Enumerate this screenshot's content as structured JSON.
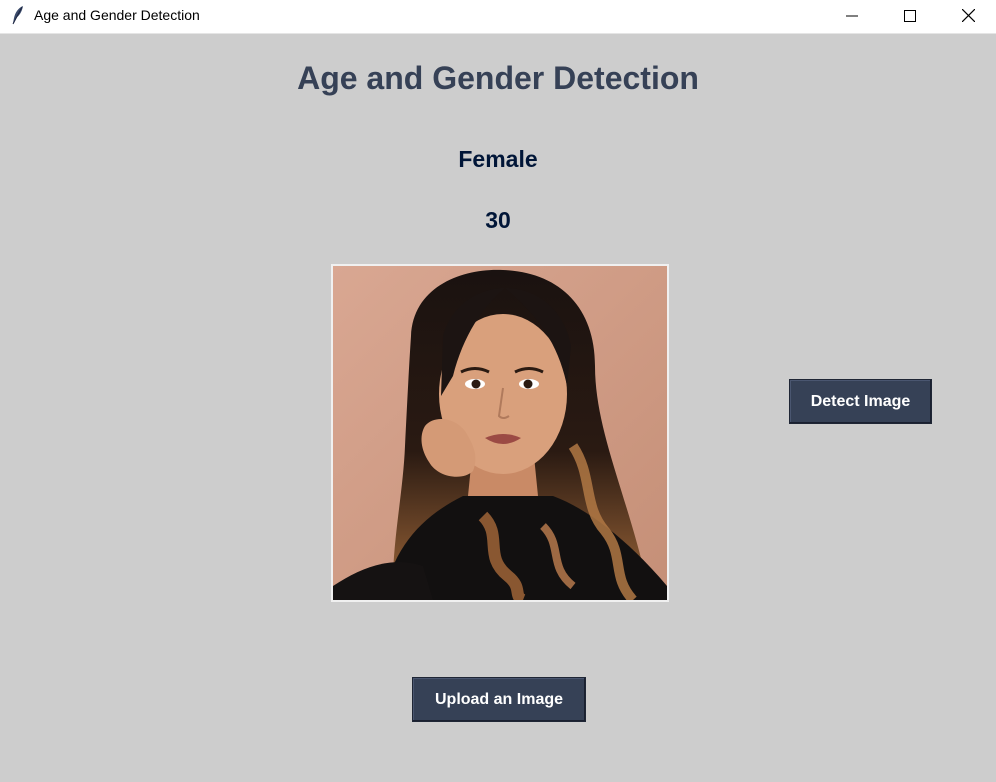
{
  "window": {
    "title": "Age and Gender Detection"
  },
  "main": {
    "title": "Age and Gender Detection",
    "gender_result": "Female",
    "age_result": "30"
  },
  "buttons": {
    "detect_label": "Detect Image",
    "upload_label": "Upload an Image"
  },
  "colors": {
    "background": "#cdcdcd",
    "title_text": "#364156",
    "result_text": "#011638",
    "button_bg": "#364156",
    "button_text": "#ffffff"
  },
  "image": {
    "icon": "portrait-photo-icon"
  }
}
